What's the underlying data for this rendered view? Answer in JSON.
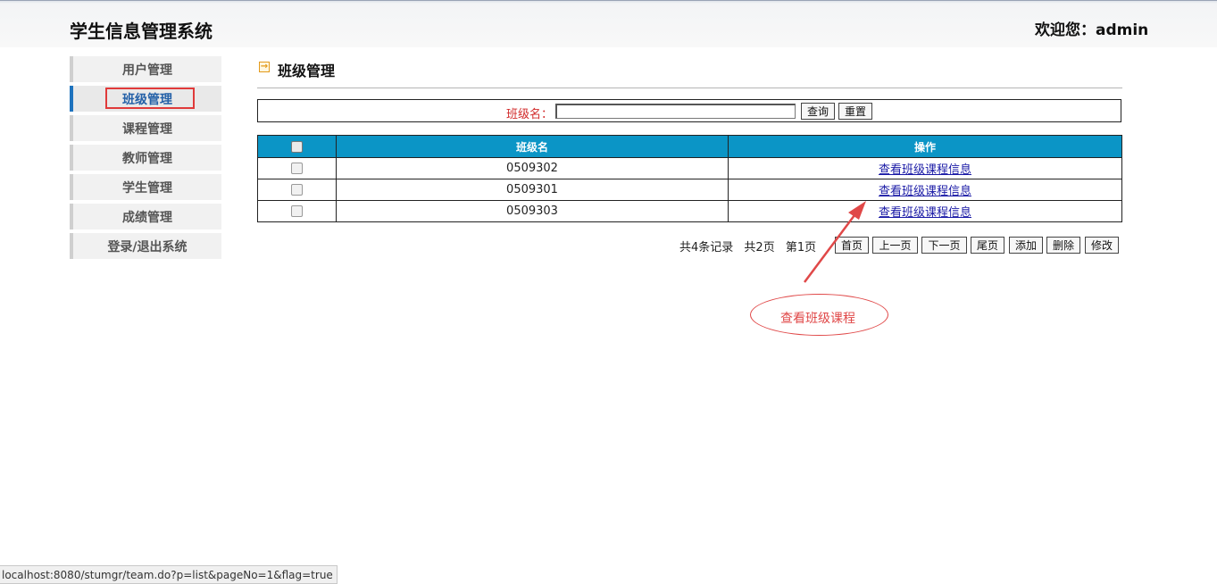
{
  "header": {
    "title": "学生信息管理系统",
    "welcome": "欢迎您：admin"
  },
  "sidebar": {
    "items": [
      {
        "label": "用户管理",
        "active": false
      },
      {
        "label": "班级管理",
        "active": true
      },
      {
        "label": "课程管理",
        "active": false
      },
      {
        "label": "教师管理",
        "active": false
      },
      {
        "label": "学生管理",
        "active": false
      },
      {
        "label": "成绩管理",
        "active": false
      },
      {
        "label": "登录/退出系统",
        "active": false
      }
    ]
  },
  "main": {
    "title": "班级管理",
    "search": {
      "label": "班级名：",
      "value": "",
      "query_button": "查询",
      "reset_button": "重置"
    },
    "table": {
      "columns": [
        "",
        "班级名",
        "操作"
      ],
      "rows": [
        {
          "name": "0509302",
          "action": "查看班级课程信息"
        },
        {
          "name": "0509301",
          "action": "查看班级课程信息"
        },
        {
          "name": "0509303",
          "action": "查看班级课程信息"
        }
      ]
    },
    "pager": {
      "total_records": "共4条记录",
      "total_pages": "共2页",
      "current_page": "第1页",
      "buttons": {
        "first": "首页",
        "prev": "上一页",
        "next": "下一页",
        "last": "尾页",
        "add": "添加",
        "delete": "删除",
        "edit": "修改"
      }
    }
  },
  "annotation": {
    "text": "查看班级课程",
    "color": "#e04848"
  },
  "status_bar": {
    "url": "localhost:8080/stumgr/team.do?p=list&pageNo=1&flag=true"
  },
  "colors": {
    "table_header": "#0b95c6",
    "active_accent": "#1e73be",
    "highlight": "#e03a3a"
  }
}
